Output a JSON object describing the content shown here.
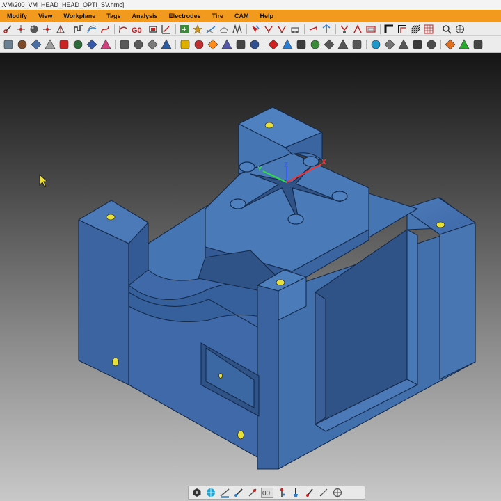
{
  "window": {
    "title": ".VM\\200_VM_HEAD_HEAD_OPTI_SV.hmc]"
  },
  "menu": {
    "items": [
      {
        "id": "modify",
        "label": "Modify"
      },
      {
        "id": "view",
        "label": "View"
      },
      {
        "id": "workplane",
        "label": "Workplane"
      },
      {
        "id": "tags",
        "label": "Tags"
      },
      {
        "id": "analysis",
        "label": "Analysis"
      },
      {
        "id": "electrodes",
        "label": "Electrodes"
      },
      {
        "id": "tire",
        "label": "Tire"
      },
      {
        "id": "cam",
        "label": "CAM"
      },
      {
        "id": "help",
        "label": "Help"
      }
    ]
  },
  "toolbar_top": {
    "g0_label": "G0",
    "icons": [
      "cut-icon",
      "point-icon",
      "sphere-icon",
      "move-icon",
      "transform-icon",
      "surface-icon",
      "offset-icon",
      "curve-icon",
      "arc-icon",
      "loop-icon",
      "rect-icon",
      "workplane-icon",
      "star-icon",
      "plane-icon",
      "fillet-icon",
      "cone-icon",
      "zigzag-icon",
      "select-icon",
      "merge-icon",
      "scan-icon",
      "slope-icon",
      "sketch-icon",
      "lens-icon",
      "mesh-icon",
      "corner-icon",
      "corner-alt-icon",
      "hatch-icon",
      "wave-icon",
      "zoom-icon",
      "mesh-view-icon"
    ]
  },
  "toolbar_main": {
    "icons": [
      "new-icon",
      "open-icon",
      "save-icon",
      "stock-icon",
      "import-icon",
      "blade-icon",
      "edit-icon",
      "paint-icon",
      "undo-icon",
      "redo-icon",
      "ruler-icon",
      "solid-icon",
      "warning-icon",
      "hat-icon",
      "processing-icon",
      "calc-icon",
      "tool-icon",
      "boot-icon",
      "spark-icon",
      "ball-icon",
      "layer-icon",
      "surface-tool-icon",
      "sine-icon",
      "arrow-icon",
      "curve-tool-icon",
      "simulate-icon",
      "rotate-icon",
      "machine-icon",
      "crosshair-icon",
      "gem-icon",
      "edit-nc-icon",
      "play-icon",
      "next-icon"
    ],
    "colors": [
      "#6b7f93",
      "#7d4a2a",
      "#4a6fa5",
      "#a0a0a0",
      "#cc2222",
      "#2e6b3b",
      "#3559a8",
      "#d04080",
      "#5a5a5a",
      "#5a5a5a",
      "#7a7a7a",
      "#2c5aa0",
      "#e0b000",
      "#c03030",
      "#ff8c1a",
      "#5555aa",
      "#444444",
      "#2f4f8f",
      "#d02020",
      "#2a7fd4",
      "#3b3b3b",
      "#3a8a3a",
      "#555555",
      "#555555",
      "#555555",
      "#2196c8",
      "#777777",
      "#555555",
      "#3a3a3a",
      "#4a4a4a",
      "#e07020",
      "#2aaa2a",
      "#444444"
    ]
  },
  "toolbar_bottom": {
    "label_00": "00",
    "icons": [
      "hexagon-icon",
      "globe-icon",
      "measure-icon",
      "brush-icon",
      "laser-icon",
      "double-zero-icon",
      "pin-icon",
      "paintbrush-icon",
      "select-pen-icon",
      "stylus-icon",
      "target-icon"
    ]
  },
  "viewport": {
    "axes": {
      "x": "X",
      "y": "Y",
      "z": "Z"
    },
    "colors": {
      "part_main": "#3f69a8",
      "part_light": "#4c7ab9",
      "part_dark": "#2f5287",
      "edge": "#142a4a",
      "hole": "#e7e03a",
      "axis_x": "#ff3030",
      "axis_y": "#30e040",
      "axis_z": "#3a5cff"
    }
  }
}
